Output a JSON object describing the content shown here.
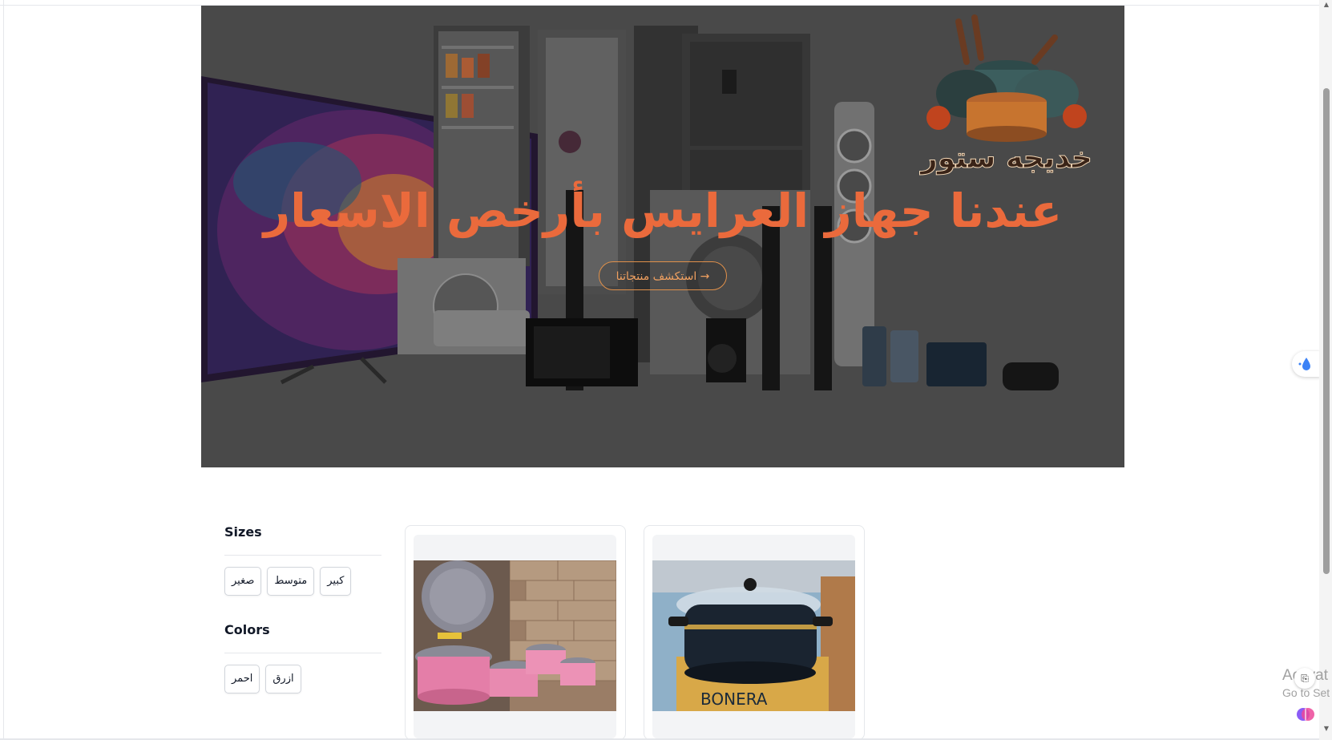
{
  "hero": {
    "title": "عندنا جهاز العرايس بأرخص الاسعار",
    "cta_label": "→ استكشف منتجاتنا",
    "logo_text": "خديجه ستور",
    "accent_color": "#ea6a3c",
    "overlay_color": "#5c5c5c"
  },
  "filters": {
    "sizes_title": "Sizes",
    "sizes": [
      "كبير",
      "متوسط",
      "صغير"
    ],
    "colors_title": "Colors",
    "colors": [
      "ازرق",
      "احمر"
    ]
  },
  "products": [
    {
      "image": "pink-cookware-set-photo"
    },
    {
      "image": "black-gold-pot-bonera-photo"
    }
  ],
  "system": {
    "watermark_line1": "Activat",
    "watermark_line2": "Go to Set"
  }
}
